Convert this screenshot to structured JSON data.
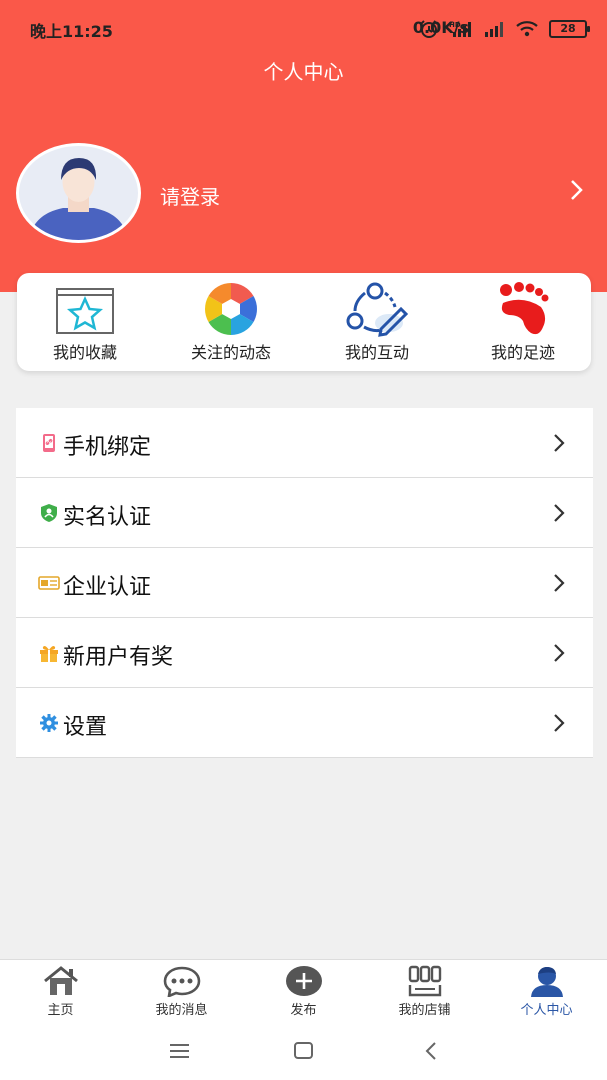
{
  "status_bar": {
    "time": "晚上11:25",
    "network_speed": "0.0K/s",
    "battery": "28"
  },
  "header": {
    "title": "个人中心",
    "login_text": "请登录",
    "bg_color": "#fa5849"
  },
  "quick_actions": [
    {
      "label": "我的收藏",
      "icon": "star-icon"
    },
    {
      "label": "关注的动态",
      "icon": "aperture-icon"
    },
    {
      "label": "我的互动",
      "icon": "interaction-icon"
    },
    {
      "label": "我的足迹",
      "icon": "footprint-icon"
    }
  ],
  "menu": [
    {
      "label": "手机绑定",
      "icon": "phone-link-icon"
    },
    {
      "label": "实名认证",
      "icon": "shield-user-icon"
    },
    {
      "label": "企业认证",
      "icon": "enterprise-card-icon"
    },
    {
      "label": "新用户有奖",
      "icon": "gift-icon"
    },
    {
      "label": "设置",
      "icon": "gear-icon"
    }
  ],
  "tabbar": [
    {
      "label": "主页",
      "icon": "home-icon"
    },
    {
      "label": "我的消息",
      "icon": "chat-icon"
    },
    {
      "label": "发布",
      "icon": "plus-circle-icon"
    },
    {
      "label": "我的店铺",
      "icon": "shop-icon"
    },
    {
      "label": "个人中心",
      "icon": "person-icon",
      "active": true
    }
  ],
  "colors": {
    "accent": "#fa5849",
    "active_tab": "#2a56a6"
  }
}
